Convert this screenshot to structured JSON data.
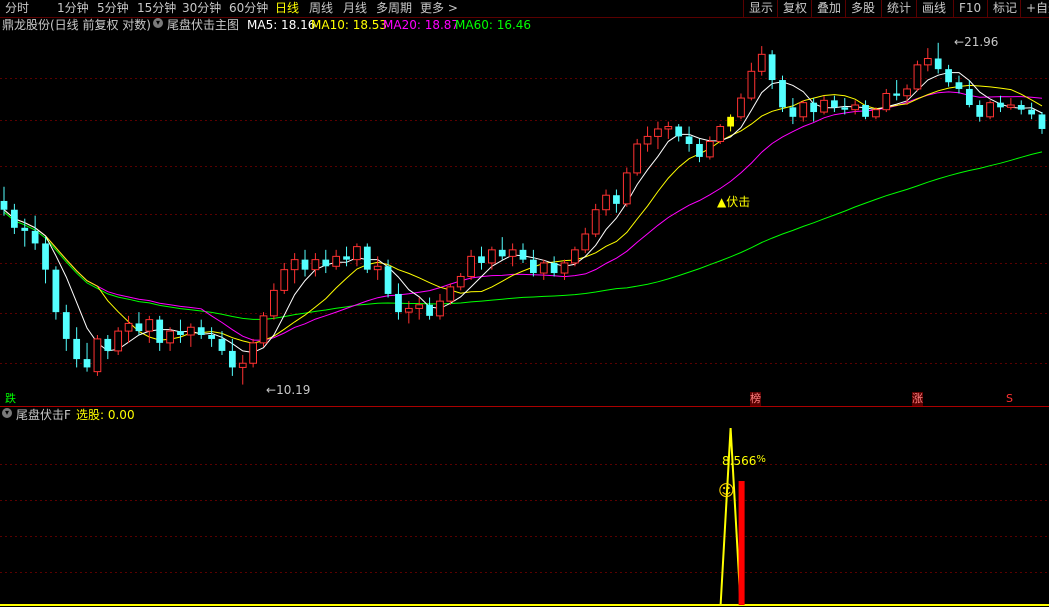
{
  "toolbar": {
    "left_tabs": [
      "分时",
      "1分钟",
      "5分钟",
      "15分钟",
      "30分钟",
      "60分钟",
      "日线",
      "周线",
      "月线",
      "多周期",
      "更多"
    ],
    "active_tab": "日线",
    "more_arrow": ">",
    "right_buttons": [
      "显示",
      "复权",
      "叠加",
      "多股",
      "统计",
      "画线",
      "F10",
      "标记",
      "+自选"
    ]
  },
  "main_header": {
    "stock_title": "鼎龙股份(日线 前复权 对数)",
    "indicator_name": "尾盘伏击主图",
    "ma5_label": "MA5: 18.16",
    "ma10_label": "MA10: 18.53",
    "ma20_label": "MA20: 18.87",
    "ma60_label": "MA60: 16.46"
  },
  "main_annotations": {
    "high_label": "21.96",
    "low_label": "10.19",
    "signal_label": "▲伏击",
    "tag_die": "跌",
    "tag_bang": "榜",
    "tag_zhang": "涨",
    "tag_s": "S"
  },
  "sub_header": {
    "indicator_name": "尾盘伏击F",
    "select_label": "选股: 0.00"
  },
  "sub_annotations": {
    "peak_label": "8.566",
    "percent_sign": "%",
    "smiley": "☺"
  },
  "colors": {
    "up": "#ff3232",
    "down": "#54ffff",
    "ma5": "#ffffff",
    "ma10": "#ffff00",
    "ma20": "#ff00ff",
    "ma60": "#00ff00",
    "grid": "#5a0000",
    "signal": "#ffff00"
  },
  "chart_data": {
    "type": "candlestick",
    "title": "鼎龙股份(日线 前复权 对数)",
    "price_range": [
      10.19,
      21.96
    ],
    "ohlc": [
      [
        15.4,
        15.9,
        14.9,
        15.1
      ],
      [
        15.1,
        15.3,
        14.3,
        14.5
      ],
      [
        14.5,
        14.8,
        13.9,
        14.4
      ],
      [
        14.4,
        14.9,
        13.8,
        14.0
      ],
      [
        14.0,
        14.2,
        12.8,
        13.2
      ],
      [
        13.2,
        13.3,
        11.8,
        12.0
      ],
      [
        12.0,
        12.2,
        11.0,
        11.3
      ],
      [
        11.3,
        11.6,
        10.6,
        10.8
      ],
      [
        10.8,
        11.2,
        10.5,
        10.6
      ],
      [
        10.5,
        11.4,
        10.4,
        11.3
      ],
      [
        11.3,
        11.4,
        10.8,
        11.0
      ],
      [
        11.0,
        11.6,
        10.9,
        11.5
      ],
      [
        11.5,
        11.9,
        11.2,
        11.7
      ],
      [
        11.7,
        12.0,
        11.4,
        11.5
      ],
      [
        11.5,
        11.9,
        11.2,
        11.8
      ],
      [
        11.8,
        11.9,
        11.0,
        11.2
      ],
      [
        11.2,
        11.6,
        11.0,
        11.5
      ],
      [
        11.5,
        11.8,
        11.2,
        11.4
      ],
      [
        11.4,
        11.7,
        11.1,
        11.6
      ],
      [
        11.6,
        11.8,
        11.3,
        11.4
      ],
      [
        11.4,
        11.6,
        11.1,
        11.3
      ],
      [
        11.3,
        11.5,
        10.9,
        11.0
      ],
      [
        11.0,
        11.3,
        10.4,
        10.6
      ],
      [
        10.6,
        10.9,
        10.2,
        10.7
      ],
      [
        10.7,
        11.3,
        10.6,
        11.2
      ],
      [
        11.2,
        12.0,
        11.1,
        11.9
      ],
      [
        11.9,
        12.8,
        11.8,
        12.6
      ],
      [
        12.6,
        13.4,
        12.5,
        13.2
      ],
      [
        13.2,
        13.7,
        12.8,
        13.5
      ],
      [
        13.5,
        13.8,
        13.0,
        13.2
      ],
      [
        13.2,
        13.7,
        13.0,
        13.5
      ],
      [
        13.5,
        13.8,
        13.1,
        13.3
      ],
      [
        13.3,
        13.8,
        13.2,
        13.6
      ],
      [
        13.6,
        13.9,
        13.3,
        13.5
      ],
      [
        13.5,
        14.0,
        13.3,
        13.9
      ],
      [
        13.9,
        14.0,
        13.1,
        13.2
      ],
      [
        13.2,
        13.6,
        12.9,
        13.3
      ],
      [
        13.3,
        13.5,
        12.4,
        12.5
      ],
      [
        12.5,
        12.8,
        11.8,
        12.0
      ],
      [
        12.0,
        12.3,
        11.7,
        12.1
      ],
      [
        12.1,
        12.4,
        11.8,
        12.2
      ],
      [
        12.2,
        12.4,
        11.8,
        11.9
      ],
      [
        11.9,
        12.5,
        11.8,
        12.3
      ],
      [
        12.3,
        12.8,
        12.2,
        12.7
      ],
      [
        12.7,
        13.1,
        12.6,
        13.0
      ],
      [
        13.0,
        13.8,
        12.9,
        13.6
      ],
      [
        13.6,
        13.9,
        13.2,
        13.4
      ],
      [
        13.4,
        13.9,
        13.2,
        13.8
      ],
      [
        13.8,
        14.2,
        13.5,
        13.6
      ],
      [
        13.6,
        14.0,
        13.3,
        13.8
      ],
      [
        13.8,
        14.0,
        13.4,
        13.5
      ],
      [
        13.5,
        13.8,
        13.0,
        13.1
      ],
      [
        13.1,
        13.5,
        12.9,
        13.4
      ],
      [
        13.4,
        13.6,
        13.0,
        13.1
      ],
      [
        13.1,
        13.5,
        12.9,
        13.4
      ],
      [
        13.4,
        13.9,
        13.3,
        13.8
      ],
      [
        13.8,
        14.5,
        13.7,
        14.3
      ],
      [
        14.3,
        15.3,
        14.2,
        15.1
      ],
      [
        15.1,
        15.8,
        14.9,
        15.6
      ],
      [
        15.6,
        15.8,
        15.0,
        15.3
      ],
      [
        15.3,
        16.6,
        15.2,
        16.4
      ],
      [
        16.4,
        17.7,
        16.3,
        17.5
      ],
      [
        17.5,
        18.2,
        17.2,
        17.8
      ],
      [
        17.8,
        18.4,
        17.3,
        18.1
      ],
      [
        18.1,
        18.4,
        17.7,
        18.2
      ],
      [
        18.2,
        18.3,
        17.6,
        17.8
      ],
      [
        17.8,
        18.2,
        17.2,
        17.5
      ],
      [
        17.5,
        17.7,
        16.8,
        17.0
      ],
      [
        17.0,
        17.8,
        16.9,
        17.6
      ],
      [
        17.6,
        18.3,
        17.5,
        18.2
      ],
      [
        18.2,
        18.7,
        18.0,
        18.6
      ],
      [
        18.6,
        19.6,
        18.5,
        19.4
      ],
      [
        19.4,
        21.0,
        19.3,
        20.6
      ],
      [
        20.6,
        21.8,
        20.4,
        21.4
      ],
      [
        21.4,
        21.6,
        19.8,
        20.2
      ],
      [
        20.2,
        20.4,
        18.8,
        19.0
      ],
      [
        19.0,
        19.4,
        18.3,
        18.6
      ],
      [
        18.6,
        19.3,
        18.4,
        19.2
      ],
      [
        19.2,
        19.4,
        18.4,
        18.8
      ],
      [
        18.8,
        19.5,
        18.7,
        19.3
      ],
      [
        19.3,
        19.5,
        18.8,
        19.0
      ],
      [
        19.0,
        19.4,
        18.7,
        18.9
      ],
      [
        18.9,
        19.3,
        18.7,
        19.1
      ],
      [
        19.1,
        19.3,
        18.5,
        18.6
      ],
      [
        18.6,
        19.0,
        18.5,
        18.9
      ],
      [
        18.9,
        19.8,
        18.8,
        19.6
      ],
      [
        19.6,
        20.2,
        19.3,
        19.5
      ],
      [
        19.5,
        20.0,
        19.1,
        19.8
      ],
      [
        19.8,
        21.1,
        19.7,
        20.9
      ],
      [
        20.9,
        21.7,
        20.6,
        21.2
      ],
      [
        21.2,
        21.96,
        20.5,
        20.7
      ],
      [
        20.7,
        20.9,
        19.9,
        20.1
      ],
      [
        20.1,
        20.4,
        19.6,
        19.8
      ],
      [
        19.8,
        20.2,
        19.0,
        19.1
      ],
      [
        19.1,
        19.3,
        18.4,
        18.6
      ],
      [
        18.6,
        19.3,
        18.5,
        19.2
      ],
      [
        19.2,
        19.5,
        18.8,
        19.0
      ],
      [
        19.0,
        19.4,
        18.9,
        19.1
      ],
      [
        19.1,
        19.3,
        18.7,
        18.9
      ],
      [
        18.9,
        19.2,
        18.5,
        18.7
      ],
      [
        18.7,
        18.8,
        17.9,
        18.1
      ]
    ],
    "ma5": 18.16,
    "ma10": 18.53,
    "ma20": 18.87,
    "ma60": 16.46,
    "signal_day_index": 70,
    "sub_indicator": {
      "name": "尾盘伏击F",
      "peak_value": 8.566,
      "peak_day_index": 70,
      "bar_value": 6.0,
      "range": [
        0,
        8.566
      ]
    }
  }
}
